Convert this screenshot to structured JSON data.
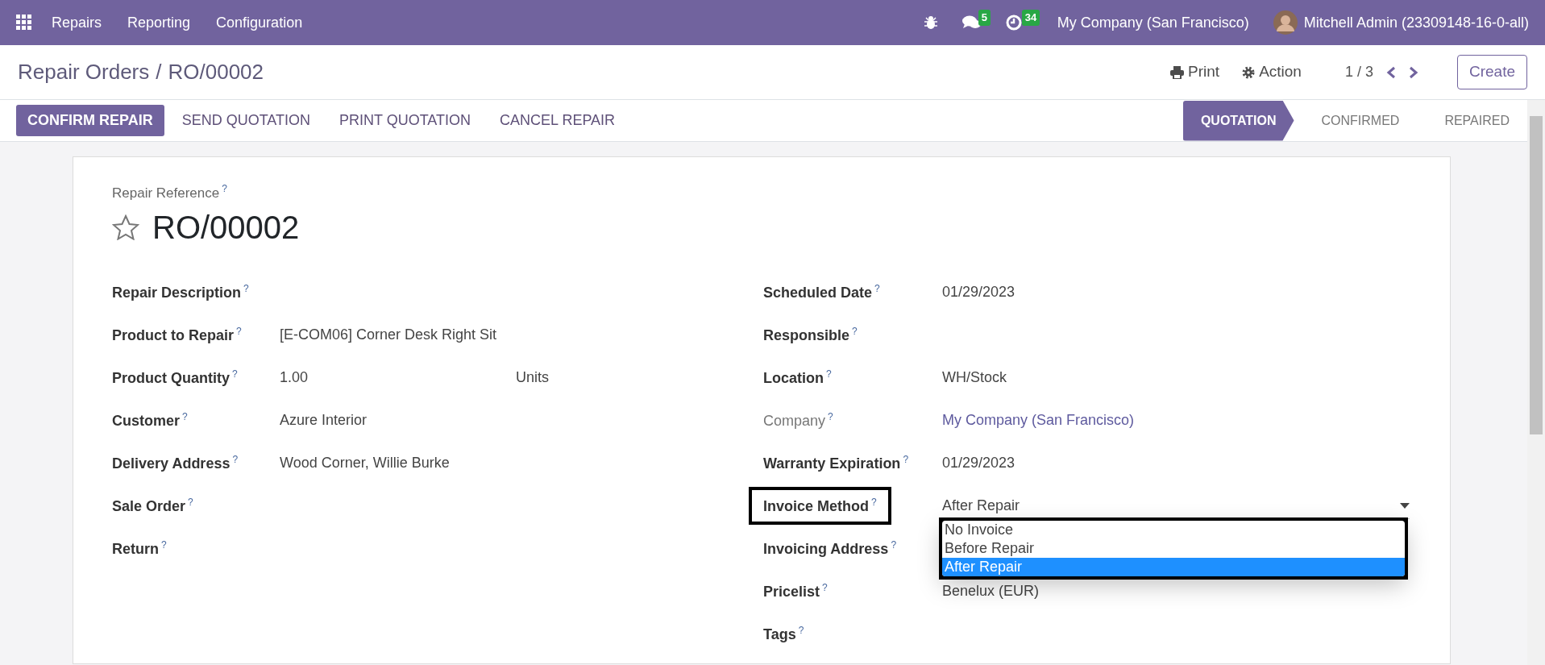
{
  "navbar": {
    "app_name": "Repairs",
    "menu": [
      "Reporting",
      "Configuration"
    ],
    "messages_count": "5",
    "activities_count": "34",
    "company": "My Company (San Francisco)",
    "user": "Mitchell Admin (23309148-16-0-all)"
  },
  "control_panel": {
    "breadcrumb": [
      "Repair Orders",
      "RO/00002"
    ],
    "separator": "/",
    "help_mark": "?",
    "print": "Print",
    "action": "Action",
    "pager": "1 / 3",
    "create": "Create"
  },
  "action_buttons": [
    {
      "label": "CONFIRM REPAIR",
      "kind": "primary"
    },
    {
      "label": "SEND QUOTATION",
      "kind": "secondary"
    },
    {
      "label": "PRINT QUOTATION",
      "kind": "secondary"
    },
    {
      "label": "CANCEL REPAIR",
      "kind": "secondary"
    }
  ],
  "stages": [
    {
      "label": "QUOTATION",
      "selected": true
    },
    {
      "label": "CONFIRMED",
      "selected": false
    },
    {
      "label": "REPAIRED",
      "selected": false
    }
  ],
  "form": {
    "reference_label": "Repair Reference",
    "reference": "RO/00002",
    "starred": false,
    "left_fields": [
      {
        "label": "Repair Description"
      },
      {
        "label": "Product to Repair",
        "value": "[E-COM06] Corner Desk Right Sit"
      },
      {
        "label": "Product Quantity",
        "value": "1.00",
        "unit": "Units"
      },
      {
        "label": "Customer",
        "value": "Azure Interior"
      },
      {
        "label": "Delivery Address",
        "value": "Wood Corner, Willie Burke"
      },
      {
        "label": "Sale Order"
      },
      {
        "label": "Return"
      }
    ],
    "right_fields": [
      {
        "label": "Scheduled Date",
        "value": "01/29/2023"
      },
      {
        "label": "Responsible"
      },
      {
        "label": "Location",
        "value": "WH/Stock"
      },
      {
        "label": "Company",
        "value": "My Company (San Francisco)",
        "readonly": true,
        "kind": "link"
      },
      {
        "label": "Warranty Expiration",
        "value": "01/29/2023"
      },
      {
        "label": "Invoice Method",
        "value": "After Repair",
        "kind": "select",
        "highlighted": true,
        "options": [
          {
            "label": "No Invoice",
            "selected": false
          },
          {
            "label": "Before Repair",
            "selected": false
          },
          {
            "label": "After Repair",
            "selected": true
          }
        ]
      },
      {
        "label": "Invoicing Address"
      },
      {
        "label": "Pricelist",
        "value": "Benelux (EUR)"
      },
      {
        "label": "Tags"
      }
    ]
  }
}
